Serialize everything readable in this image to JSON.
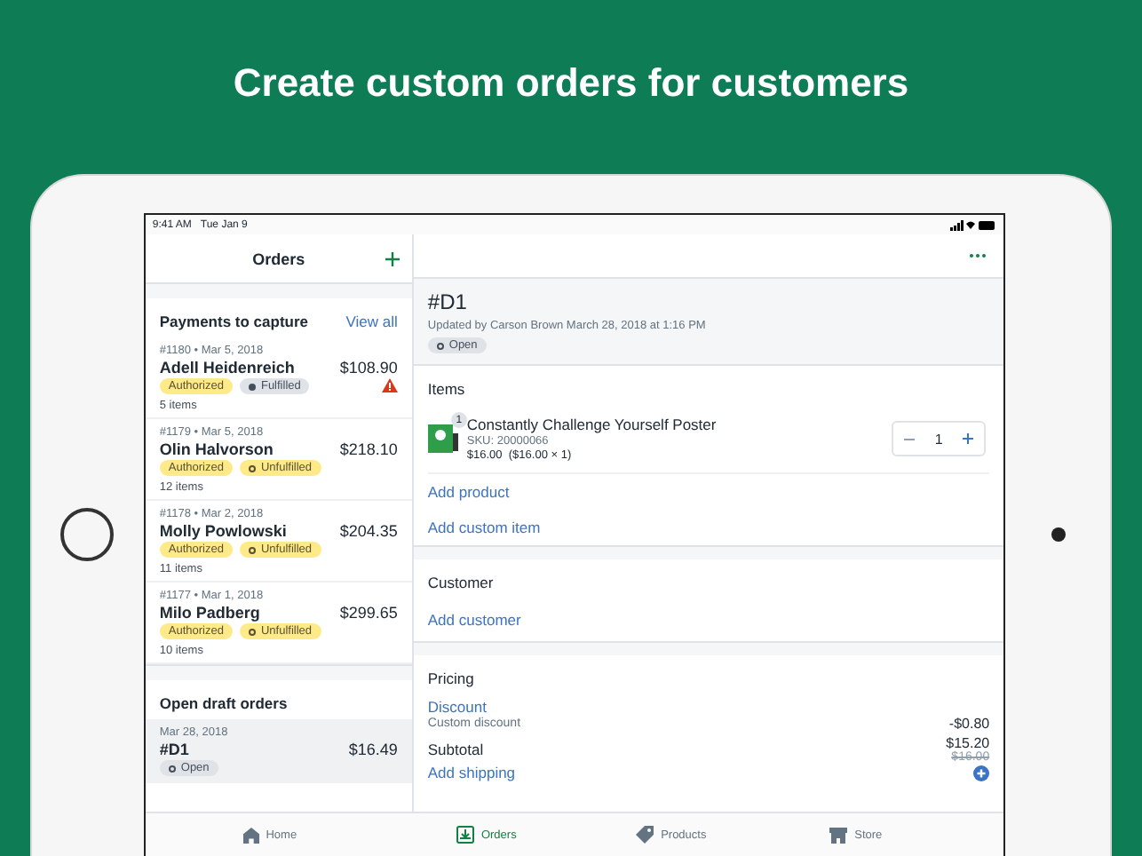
{
  "headline": "Create custom orders for customers",
  "status_bar": {
    "time": "9:41 AM",
    "date": "Tue Jan 9"
  },
  "orders_pane": {
    "title": "Orders",
    "payments": {
      "title": "Payments to capture",
      "link": "View all",
      "orders": [
        {
          "number_date": "#1180 • Mar 5, 2018",
          "customer": "Adell Heidenreich",
          "total": "$108.90",
          "payment_status": "Authorized",
          "fulfillment_status": "Fulfilled",
          "fulfilled": true,
          "warning": true,
          "items": "5 items"
        },
        {
          "number_date": "#1179 • Mar 5, 2018",
          "customer": "Olin Halvorson",
          "total": "$218.10",
          "payment_status": "Authorized",
          "fulfillment_status": "Unfulfilled",
          "fulfilled": false,
          "warning": false,
          "items": "12 items"
        },
        {
          "number_date": "#1178 • Mar 2, 2018",
          "customer": "Molly Powlowski",
          "total": "$204.35",
          "payment_status": "Authorized",
          "fulfillment_status": "Unfulfilled",
          "fulfilled": false,
          "warning": false,
          "items": "11 items"
        },
        {
          "number_date": "#1177 • Mar 1, 2018",
          "customer": "Milo Padberg",
          "total": "$299.65",
          "payment_status": "Authorized",
          "fulfillment_status": "Unfulfilled",
          "fulfilled": false,
          "warning": false,
          "items": "10 items"
        }
      ]
    },
    "drafts": {
      "title": "Open draft orders",
      "orders": [
        {
          "date": "Mar 28, 2018",
          "number": "#D1",
          "total": "$16.49",
          "status": "Open",
          "selected": true
        }
      ]
    }
  },
  "detail": {
    "title": "#D1",
    "updated": "Updated by Carson Brown March 28, 2018 at 1:16 PM",
    "status": "Open",
    "items": {
      "heading": "Items",
      "product": {
        "name": "Constantly Challenge Yourself Poster",
        "sku": "SKU: 20000066",
        "price": "$16.00  ($16.00 × 1)",
        "count_badge": "1",
        "quantity": "1"
      },
      "links": [
        "Add product",
        "Add custom item"
      ]
    },
    "customer": {
      "heading": "Customer",
      "link": "Add customer"
    },
    "pricing": {
      "heading": "Pricing",
      "discount_link": "Discount",
      "discount_label": "Custom discount",
      "discount_value": "-$0.80",
      "subtotal_label": "Subtotal",
      "subtotal": "$15.20",
      "subtotal_original": "$16.00",
      "shipping_link": "Add shipping"
    }
  },
  "tab_bar": [
    {
      "label": "Home",
      "kind": "home",
      "selected": false
    },
    {
      "label": "Orders",
      "kind": "orders",
      "selected": true
    },
    {
      "label": "Products",
      "kind": "products",
      "selected": false
    },
    {
      "label": "Store",
      "kind": "store",
      "selected": false
    }
  ]
}
